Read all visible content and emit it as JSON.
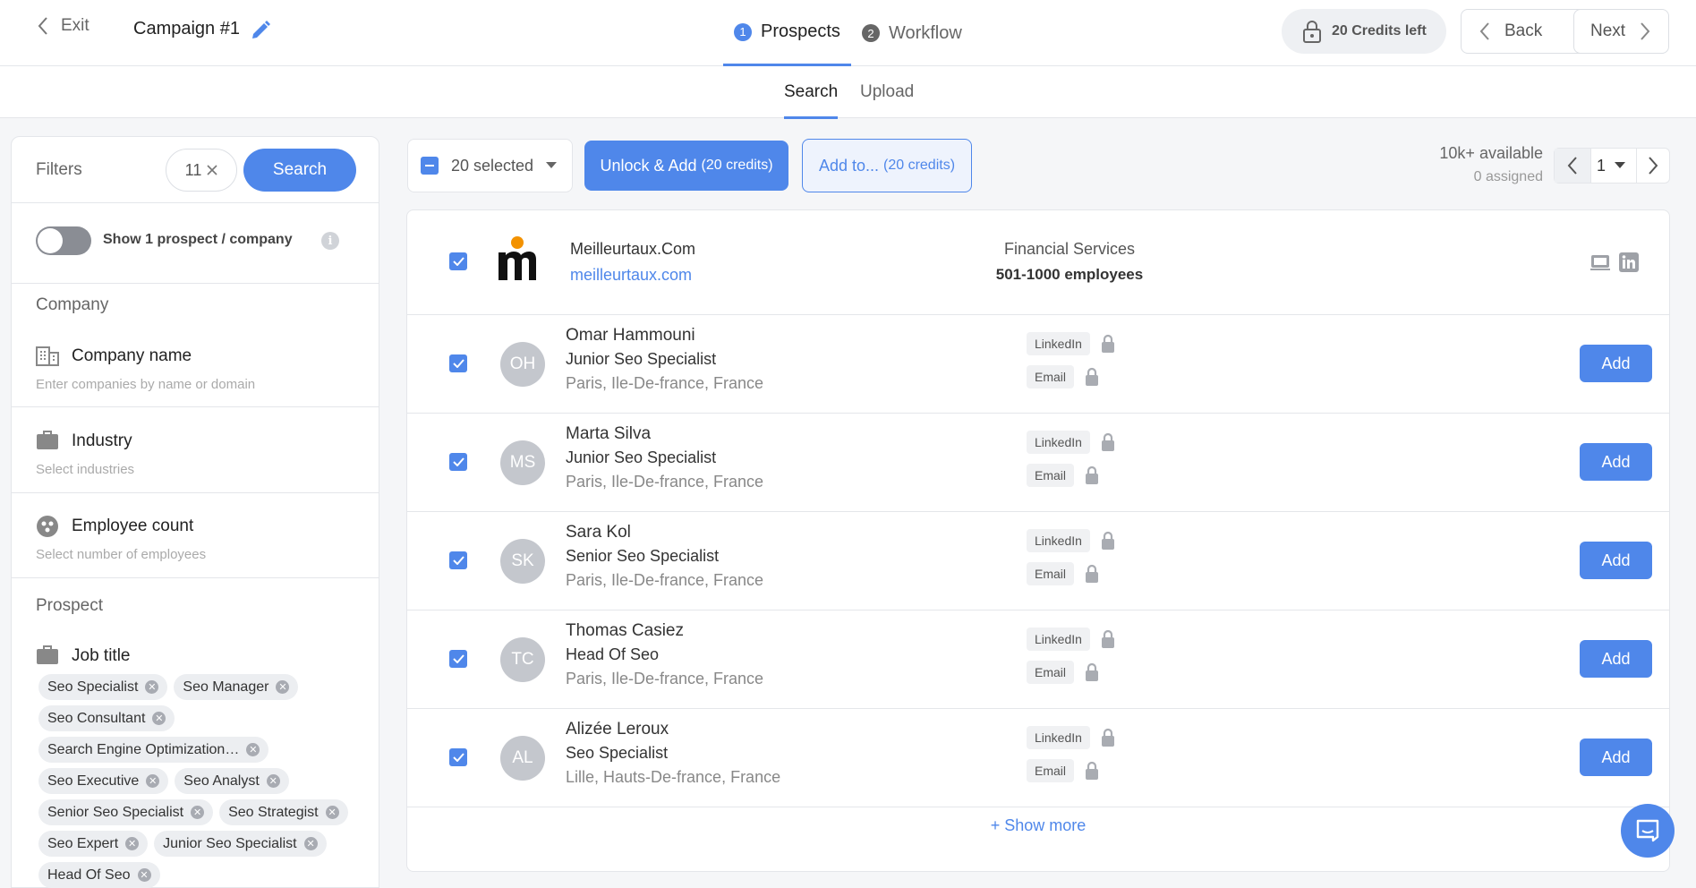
{
  "header": {
    "exit_label": "Exit",
    "campaign_title": "Campaign #1",
    "steps": [
      {
        "num": "1",
        "label": "Prospects"
      },
      {
        "num": "2",
        "label": "Workflow"
      }
    ],
    "credits_label": "20 Credits left",
    "back_label": "Back",
    "next_label": "Next"
  },
  "subtabs": [
    "Search",
    "Upload"
  ],
  "filters": {
    "label": "Filters",
    "count": "11",
    "search_label": "Search",
    "toggle_label": "Show 1 prospect / company",
    "info_glyph": "i",
    "company_section": "Company",
    "company_name": {
      "title": "Company name",
      "placeholder": "Enter companies by name or domain"
    },
    "industry": {
      "title": "Industry",
      "placeholder": "Select industries"
    },
    "employee_count": {
      "title": "Employee count",
      "placeholder": "Select number of employees"
    },
    "prospect_section": "Prospect",
    "job_title": {
      "title": "Job title",
      "chips": [
        "Seo Specialist",
        "Seo Manager",
        "Seo Consultant",
        "Search Engine Optimization…",
        "Seo Executive",
        "Seo Analyst",
        "Senior Seo Specialist",
        "Seo Strategist",
        "Seo Expert",
        "Junior Seo Specialist",
        "Head Of Seo"
      ]
    }
  },
  "toolbar": {
    "selected_label": "20 selected",
    "unlock_label": "Unlock & Add",
    "unlock_credits": "(20 credits)",
    "addto_label": "Add to...",
    "addto_credits": "(20 credits)",
    "available": "10k+ available",
    "assigned": "0 assigned",
    "page": "1"
  },
  "company": {
    "name": "Meilleurtaux.Com",
    "domain": "meilleurtaux.com",
    "industry": "Financial Services",
    "employees": "501-1000 employees"
  },
  "prospects": [
    {
      "initials": "OH",
      "name": "Omar Hammouni",
      "title": "Junior Seo Specialist",
      "location": "Paris, Ile-De-france, France"
    },
    {
      "initials": "MS",
      "name": "Marta Silva",
      "title": "Junior Seo Specialist",
      "location": "Paris, Ile-De-france, France"
    },
    {
      "initials": "SK",
      "name": "Sara Kol",
      "title": "Senior Seo Specialist",
      "location": "Paris, Ile-De-france, France"
    },
    {
      "initials": "TC",
      "name": "Thomas Casiez",
      "title": "Head Of Seo",
      "location": "Paris, Ile-De-france, France"
    },
    {
      "initials": "AL",
      "name": "Alizée Leroux",
      "title": "Seo Specialist",
      "location": "Lille, Hauts-De-france, France"
    }
  ],
  "contact_labels": {
    "linkedin": "LinkedIn",
    "email": "Email"
  },
  "add_label": "Add",
  "show_more": "+ Show more",
  "colors": {
    "accent": "#4f87ea",
    "logo_dot": "#f39200"
  }
}
